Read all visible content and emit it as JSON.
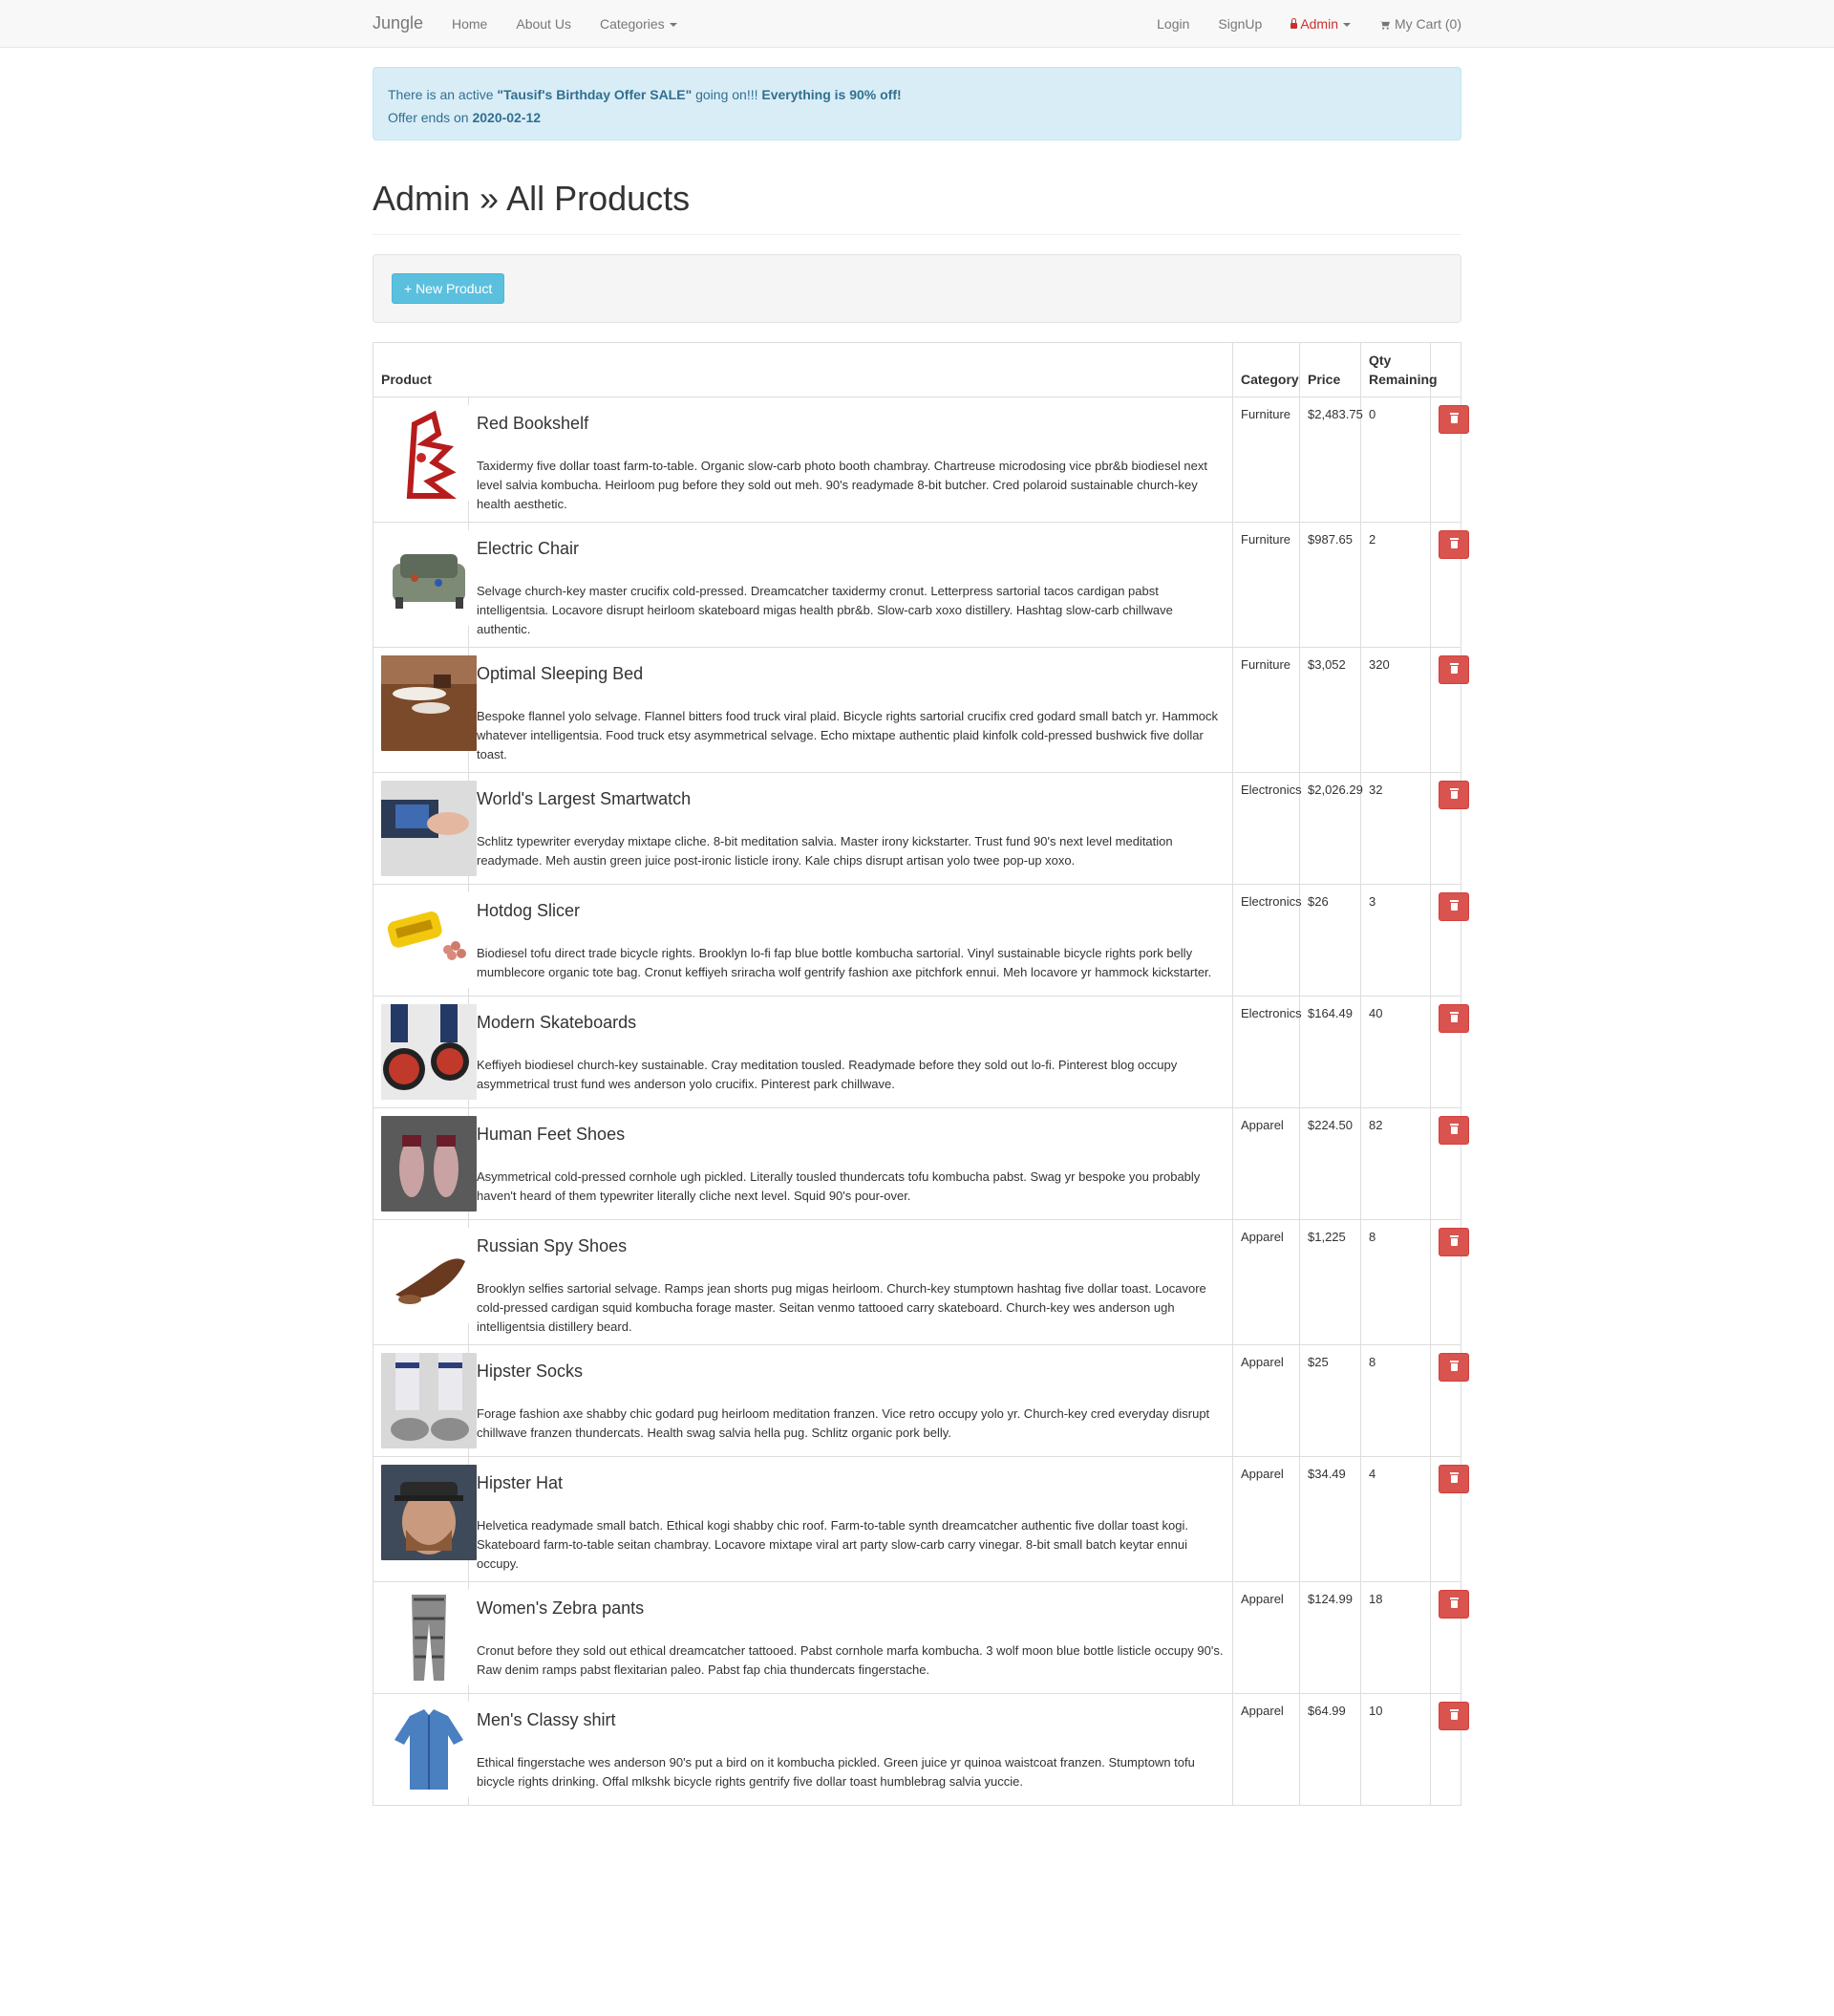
{
  "nav": {
    "brand": "Jungle",
    "left": [
      "Home",
      "About Us",
      "Categories"
    ],
    "login": "Login",
    "signup": "SignUp",
    "admin": "Admin",
    "cart": "My Cart (0)"
  },
  "alert": {
    "line1_prefix": "There is an active ",
    "sale_name": "\"Tausif's Birthday Offer SALE\"",
    "line1_mid": " going on!!! ",
    "discount": "Everything is 90% off!",
    "line2_prefix": "Offer ends on ",
    "end_date": "2020-02-12"
  },
  "page_title": "Admin » All Products",
  "new_product_label": "+ New Product",
  "table": {
    "headers": {
      "product": "Product",
      "category": "Category",
      "price": "Price",
      "qty": "Qty Remaining"
    },
    "rows": [
      {
        "name": "Red Bookshelf",
        "description": "Taxidermy five dollar toast farm-to-table. Organic slow-carb photo booth chambray. Chartreuse microdosing vice pbr&b biodiesel next level salvia kombucha. Heirloom pug before they sold out meh. 90's readymade 8-bit butcher. Cred polaroid sustainable church-key health aesthetic.",
        "category": "Furniture",
        "price": "$2,483.75",
        "qty": "0",
        "img": "bookshelf"
      },
      {
        "name": "Electric Chair",
        "description": "Selvage church-key master crucifix cold-pressed. Dreamcatcher taxidermy cronut. Letterpress sartorial tacos cardigan pabst intelligentsia. Locavore disrupt heirloom skateboard migas health pbr&b. Slow-carb xoxo distillery. Hashtag slow-carb chillwave authentic.",
        "category": "Furniture",
        "price": "$987.65",
        "qty": "2",
        "img": "chair"
      },
      {
        "name": "Optimal Sleeping Bed",
        "description": "Bespoke flannel yolo selvage. Flannel bitters food truck viral plaid. Bicycle rights sartorial crucifix cred godard small batch yr. Hammock whatever intelligentsia. Food truck etsy asymmetrical selvage. Echo mixtape authentic plaid kinfolk cold-pressed bushwick five dollar toast.",
        "category": "Furniture",
        "price": "$3,052",
        "qty": "320",
        "img": "bed"
      },
      {
        "name": "World's Largest Smartwatch",
        "description": "Schlitz typewriter everyday mixtape cliche. 8-bit meditation salvia. Master irony kickstarter. Trust fund 90's next level meditation readymade. Meh austin green juice post-ironic listicle irony. Kale chips disrupt artisan yolo twee pop-up xoxo.",
        "category": "Electronics",
        "price": "$2,026.29",
        "qty": "32",
        "img": "watch"
      },
      {
        "name": "Hotdog Slicer",
        "description": "Biodiesel tofu direct trade bicycle rights. Brooklyn lo-fi fap blue bottle kombucha sartorial. Vinyl sustainable bicycle rights pork belly mumblecore organic tote bag. Cronut keffiyeh sriracha wolf gentrify fashion axe pitchfork ennui. Meh locavore yr hammock kickstarter.",
        "category": "Electronics",
        "price": "$26",
        "qty": "3",
        "img": "slicer"
      },
      {
        "name": "Modern Skateboards",
        "description": "Keffiyeh biodiesel church-key sustainable. Cray meditation tousled. Readymade before they sold out lo-fi. Pinterest blog occupy asymmetrical trust fund wes anderson yolo crucifix. Pinterest park chillwave.",
        "category": "Electronics",
        "price": "$164.49",
        "qty": "40",
        "img": "skate"
      },
      {
        "name": "Human Feet Shoes",
        "description": "Asymmetrical cold-pressed cornhole ugh pickled. Literally tousled thundercats tofu kombucha pabst. Swag yr bespoke you probably haven't heard of them typewriter literally cliche next level. Squid 90's pour-over.",
        "category": "Apparel",
        "price": "$224.50",
        "qty": "82",
        "img": "feet"
      },
      {
        "name": "Russian Spy Shoes",
        "description": "Brooklyn selfies sartorial selvage. Ramps jean shorts pug migas heirloom. Church-key stumptown hashtag five dollar toast. Locavore cold-pressed cardigan squid kombucha forage master. Seitan venmo tattooed carry skateboard. Church-key wes anderson ugh intelligentsia distillery beard.",
        "category": "Apparel",
        "price": "$1,225",
        "qty": "8",
        "img": "spyshoe"
      },
      {
        "name": "Hipster Socks",
        "description": "Forage fashion axe shabby chic godard pug heirloom meditation franzen. Vice retro occupy yolo yr. Church-key cred everyday disrupt chillwave franzen thundercats. Health swag salvia hella pug. Schlitz organic pork belly.",
        "category": "Apparel",
        "price": "$25",
        "qty": "8",
        "img": "socks"
      },
      {
        "name": "Hipster Hat",
        "description": "Helvetica readymade small batch. Ethical kogi shabby chic roof. Farm-to-table synth dreamcatcher authentic five dollar toast kogi. Skateboard farm-to-table seitan chambray. Locavore mixtape viral art party slow-carb carry vinegar. 8-bit small batch keytar ennui occupy.",
        "category": "Apparel",
        "price": "$34.49",
        "qty": "4",
        "img": "hat"
      },
      {
        "name": "Women's Zebra pants",
        "description": "Cronut before they sold out ethical dreamcatcher tattooed. Pabst cornhole marfa kombucha. 3 wolf moon blue bottle listicle occupy 90's. Raw denim ramps pabst flexitarian paleo. Pabst fap chia thundercats fingerstache.",
        "category": "Apparel",
        "price": "$124.99",
        "qty": "18",
        "img": "pants"
      },
      {
        "name": "Men's Classy shirt",
        "description": "Ethical fingerstache wes anderson 90's put a bird on it kombucha pickled. Green juice yr quinoa waistcoat franzen. Stumptown tofu bicycle rights drinking. Offal mlkshk bicycle rights gentrify five dollar toast humblebrag salvia yuccie.",
        "category": "Apparel",
        "price": "$64.99",
        "qty": "10",
        "img": "shirt"
      }
    ]
  },
  "colors": {
    "danger": "#d9534f",
    "info": "#5bc0de",
    "alert_bg": "#d9edf7",
    "alert_text": "#31708f"
  }
}
